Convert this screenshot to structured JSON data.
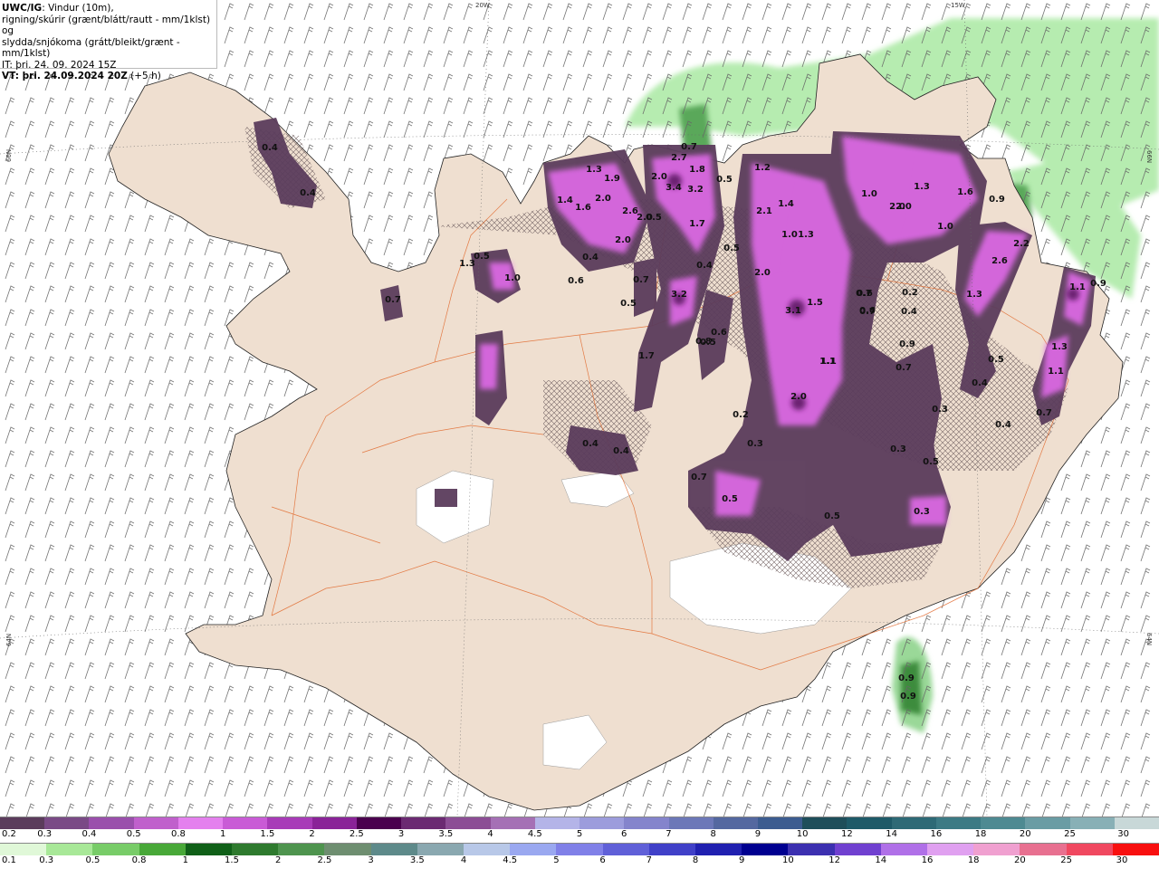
{
  "info": {
    "model": "UWC/IG",
    "line1_rest": ": Vindur (10m),",
    "line2": "rigning/skúrir (grænt/blátt/rautt - mm/1klst) og",
    "line3": "slydda/snjókoma (grátt/bleikt/grænt - mm/1klst)",
    "it": "IT: þri. 24. 09. 2024 15Z",
    "vt_label": "VT: þri. 24.09.2024 20Z",
    "vt_offset": "(+5 h)"
  },
  "graticule": {
    "top_labels": [
      "20W",
      "15W"
    ],
    "left_labels": [
      "66N",
      "64N"
    ],
    "right_labels": [
      "66N",
      "64N"
    ]
  },
  "values_snow": [
    "0.4",
    "0.4",
    "0.7",
    "1.3",
    "0.5",
    "1.0",
    "0.6",
    "1.3",
    "1.4",
    "1.6",
    "2.0",
    "1.9",
    "0.4",
    "2.6",
    "2.0",
    "2.0",
    "0.5",
    "2.7",
    "2.0",
    "3.4",
    "1.8",
    "3.2",
    "1.7",
    "0.4",
    "0.7",
    "0.5",
    "3.2",
    "1.7",
    "0.6",
    "0.5",
    "0.4",
    "0.4",
    "0.7",
    "0.5",
    "1.2",
    "0.5",
    "2.1",
    "1.4",
    "1.0",
    "1.3",
    "2.0",
    "3.1",
    "1.5",
    "1.1",
    "2.0",
    "0.2",
    "0.3",
    "0.4",
    "0.7",
    "0.6",
    "0.5",
    "1.1",
    "2.0",
    "1.3",
    "1.6",
    "1.0",
    "2.0",
    "1.0",
    "0.6",
    "0.7",
    "0.9",
    "0.3",
    "0.7",
    "0.3",
    "0.5",
    "0.3",
    "0.8",
    "0.2",
    "2.2",
    "2.6",
    "1.3",
    "0.5",
    "0.4",
    "0.4",
    "1.3",
    "1.1",
    "0.7",
    "1.1"
  ],
  "values_rain": [
    "0.7",
    "0.9",
    "0.5",
    "0.9",
    "0.9",
    "0.9"
  ],
  "legend_snow": {
    "colors": [
      "#5b3c5c",
      "#7a4a86",
      "#9a4fac",
      "#c060cc",
      "#e480ee",
      "#c95bd6",
      "#a83bb8",
      "#8a2398",
      "#4a004e",
      "#6b2a72",
      "#8c4d95",
      "#a570b5",
      "#b4b4e8",
      "#9c9cdc",
      "#8484cc",
      "#6c78b8",
      "#5468a0",
      "#3c5c90",
      "#1e4e5a",
      "#1e5a68",
      "#2e6a76",
      "#3c7a84",
      "#4e8a92",
      "#6a9ca4",
      "#88b0b6",
      "#c8d8d8"
    ],
    "labels": [
      "0.2",
      "0.3",
      "0.4",
      "0.5",
      "0.8",
      "1",
      "1.5",
      "2",
      "2.5",
      "3",
      "3.5",
      "4",
      "4.5",
      "5",
      "6",
      "7",
      "8",
      "9",
      "10",
      "12",
      "14",
      "16",
      "18",
      "20",
      "25",
      "30"
    ]
  },
  "legend_rain": {
    "colors": [
      "#e0f8d8",
      "#a8e898",
      "#78cc68",
      "#48a838",
      "#106018",
      "#2e7a2e",
      "#4e944e",
      "#6e8e70",
      "#5e8a8a",
      "#8aa8b0",
      "#b8c8e8",
      "#9aa8f0",
      "#8080e8",
      "#6060d8",
      "#4040c8",
      "#2020b0",
      "#000090",
      "#3c30b0",
      "#7040d0",
      "#b070e8",
      "#e0a0f0",
      "#f0a0d0",
      "#e87090",
      "#f04860",
      "#f81010"
    ],
    "labels": [
      "0.1",
      "0.3",
      "0.5",
      "0.8",
      "1",
      "1.5",
      "2",
      "2.5",
      "3",
      "3.5",
      "4",
      "4.5",
      "5",
      "6",
      "7",
      "8",
      "9",
      "10",
      "12",
      "14",
      "16",
      "18",
      "20",
      "25",
      "30"
    ]
  },
  "colors": {
    "land": "#efdfd0",
    "sea": "#ffffff",
    "roads": "#e06020",
    "snow_light": "#e480ee",
    "snow_dark": "#5b3c5c",
    "rain_light": "#a8e8a8",
    "rain_dark": "#2e7a2e"
  }
}
